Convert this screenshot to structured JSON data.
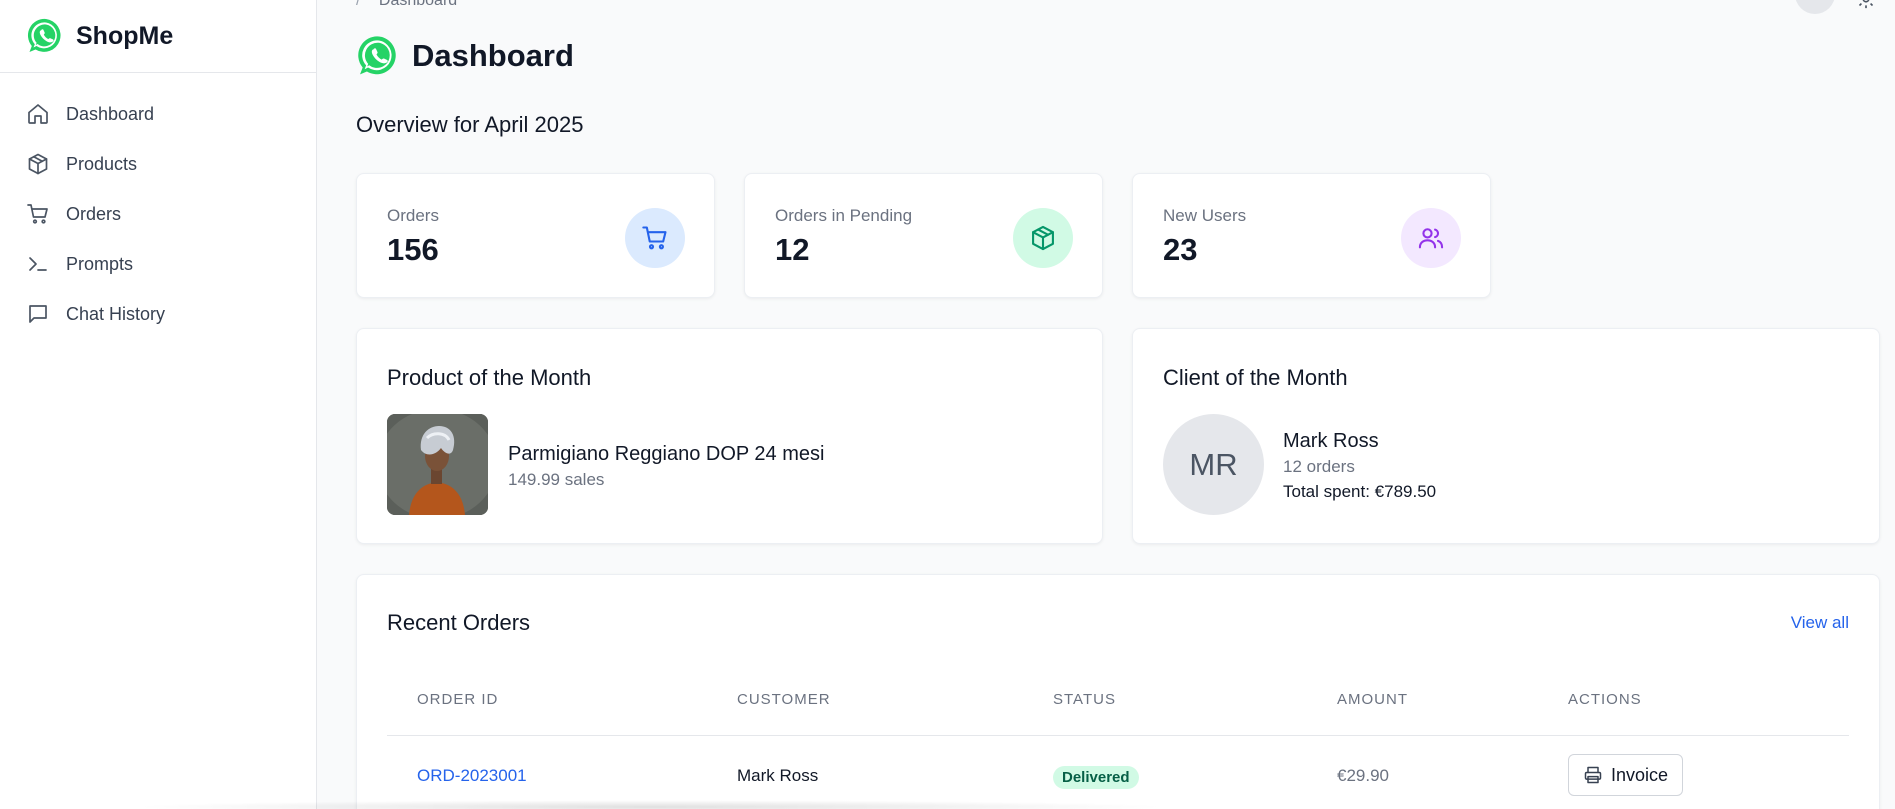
{
  "app": {
    "name": "ShopMe",
    "brand_color": "#25D366"
  },
  "sidebar": {
    "items": [
      {
        "label": "Dashboard",
        "icon": "home-icon"
      },
      {
        "label": "Products",
        "icon": "package-icon"
      },
      {
        "label": "Orders",
        "icon": "cart-icon"
      },
      {
        "label": "Prompts",
        "icon": "terminal-icon"
      },
      {
        "label": "Chat History",
        "icon": "chat-icon"
      }
    ]
  },
  "topbar": {
    "breadcrumb_cur": "Dashboard"
  },
  "page": {
    "title": "Dashboard",
    "overview": "Overview for April 2025"
  },
  "stats": [
    {
      "label": "Orders",
      "value": "156",
      "icon": "cart-icon",
      "color": "#2563eb",
      "bg": "#dbeafe"
    },
    {
      "label": "Orders in Pending",
      "value": "12",
      "icon": "package-icon",
      "color": "#059669",
      "bg": "#d1fae5"
    },
    {
      "label": "New Users",
      "value": "23",
      "icon": "users-icon",
      "color": "#9333ea",
      "bg": "#f3e8ff"
    }
  ],
  "product_of_month": {
    "title": "Product of the Month",
    "name": "Parmigiano Reggiano DOP 24 mesi",
    "sales": "149.99 sales"
  },
  "client_of_month": {
    "title": "Client of the Month",
    "initials": "MR",
    "name": "Mark Ross",
    "orders": "12 orders",
    "total_spent": "Total spent: €789.50"
  },
  "recent_orders": {
    "title": "Recent Orders",
    "view_all": "View all",
    "columns": [
      "ORDER ID",
      "CUSTOMER",
      "STATUS",
      "AMOUNT",
      "ACTIONS"
    ],
    "rows": [
      {
        "order_id": "ORD-2023001",
        "customer": "Mark Ross",
        "status": "Delivered",
        "amount": "€29.90",
        "action": "Invoice"
      }
    ]
  }
}
